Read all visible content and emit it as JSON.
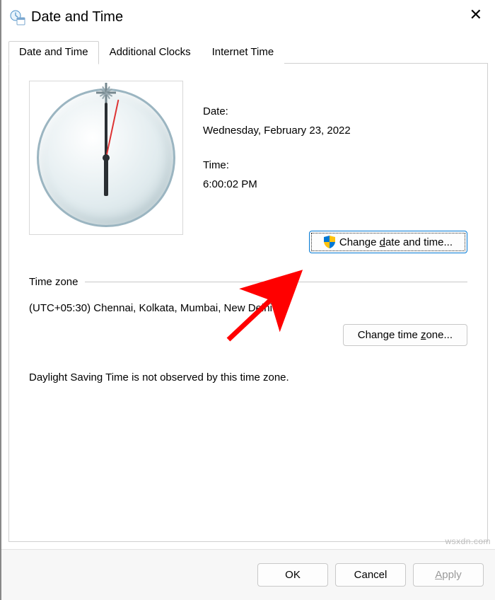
{
  "window": {
    "title": "Date and Time"
  },
  "tabs": {
    "items": [
      {
        "label": "Date and Time"
      },
      {
        "label": "Additional Clocks"
      },
      {
        "label": "Internet Time"
      }
    ]
  },
  "datetime": {
    "date_label": "Date:",
    "date_value": "Wednesday, February 23, 2022",
    "time_label": "Time:",
    "time_value": "6:00:02 PM",
    "change_btn_prefix": "Change ",
    "change_btn_key": "d",
    "change_btn_suffix": "ate and time..."
  },
  "timezone": {
    "header": "Time zone",
    "value": "(UTC+05:30) Chennai, Kolkata, Mumbai, New Delhi",
    "change_btn_prefix": "Change time ",
    "change_btn_key": "z",
    "change_btn_suffix": "one..."
  },
  "dst": {
    "note": "Daylight Saving Time is not observed by this time zone."
  },
  "footer": {
    "ok": "OK",
    "cancel": "Cancel",
    "apply_key": "A",
    "apply_suffix": "pply"
  },
  "watermark": "wsxdn.com"
}
